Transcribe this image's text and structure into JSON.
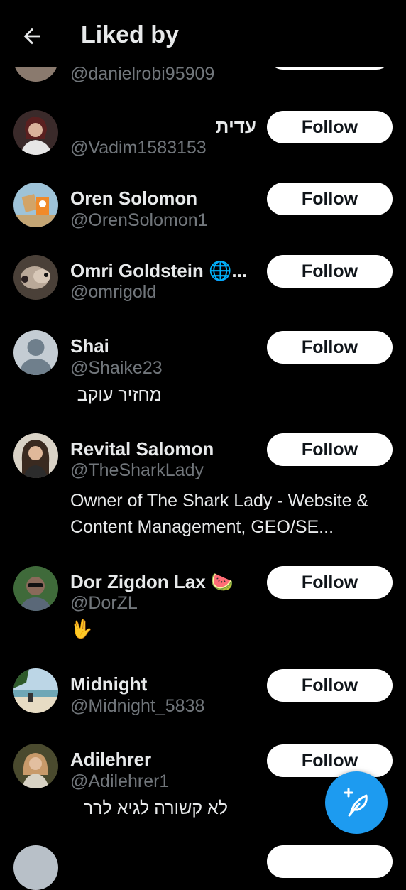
{
  "header": {
    "title": "Liked by",
    "back_icon": "arrow-left-icon"
  },
  "follow_label": "Follow",
  "users": [
    {
      "name": "",
      "handle": "@danielrobi95909",
      "bio": ""
    },
    {
      "name": "עדית",
      "handle": "@Vadim1583153",
      "bio": ""
    },
    {
      "name": "Oren Solomon",
      "handle": "@OrenSolomon1",
      "bio": ""
    },
    {
      "name": "Omri Goldstein 🌐...",
      "handle": "@omrigold",
      "bio": ""
    },
    {
      "name": "Shai",
      "handle": "@Shaike23",
      "bio": "מחזיר עוקב"
    },
    {
      "name": "Revital Salomon",
      "handle": "@TheSharkLady",
      "bio": "Owner of The Shark Lady - Website & Content Management, GEO/SE..."
    },
    {
      "name": "Dor Zigdon Lax 🍉",
      "handle": "@DorZL",
      "bio": "🖖"
    },
    {
      "name": "Midnight",
      "handle": "@Midnight_5838",
      "bio": ""
    },
    {
      "name": "Adilehrer",
      "handle": "@Adilehrer1",
      "bio": "לא קשורה לגיא לרר"
    }
  ],
  "fab": {
    "icon": "compose-feather-icon"
  },
  "colors": {
    "accent": "#1d9bf0",
    "background": "#000000",
    "secondary_text": "#71767b"
  }
}
